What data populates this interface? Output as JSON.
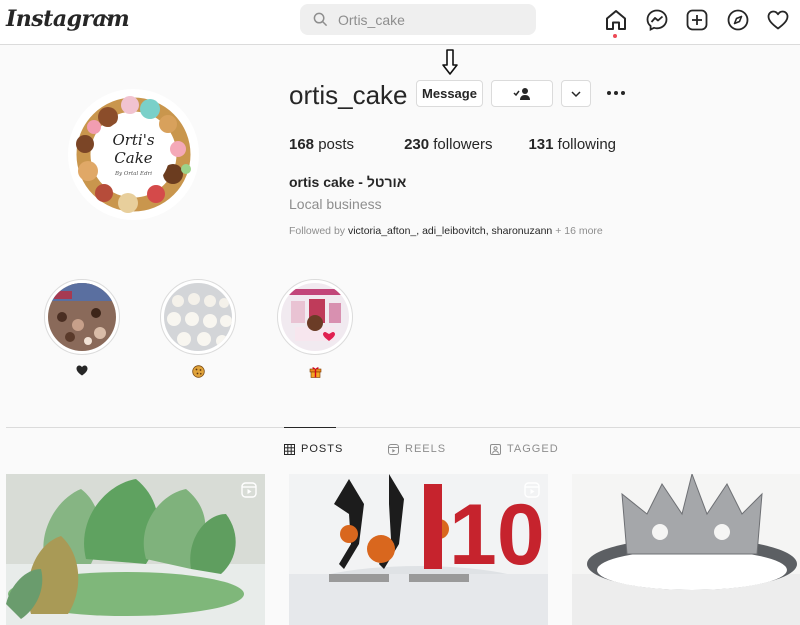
{
  "nav": {
    "logo": "Instagram",
    "search_placeholder": "Search",
    "search_value": "Ortis_cake"
  },
  "profile": {
    "username": "ortis_cake",
    "message_label": "Message",
    "stats": {
      "posts_count": "168",
      "posts_label": "posts",
      "followers_count": "230",
      "followers_label": "followers",
      "following_count": "131",
      "following_label": "following"
    },
    "display_name": "ortis cake - אורטל",
    "category": "Local business",
    "followed_by_prefix": "Followed by",
    "followed_by_names": "victoria_afton_, adi_leibovitch, sharonuzann",
    "followed_by_more": "+ 16 more",
    "avatar_text_line1": "Orti's",
    "avatar_text_line2": "Cake",
    "avatar_text_line3": "By Ortal Edri"
  },
  "highlights": [
    {
      "emoji": "❤"
    },
    {
      "emoji": "🍪"
    },
    {
      "emoji": "🎁"
    }
  ],
  "tabs": [
    {
      "label": "POSTS",
      "active": true
    },
    {
      "label": "REELS",
      "active": false
    },
    {
      "label": "TAGGED",
      "active": false
    }
  ],
  "posts": [
    {
      "subject": "leaf-cake",
      "reel": true
    },
    {
      "subject": "basketball-10-cake",
      "reel": true,
      "cake_number": "10"
    },
    {
      "subject": "crown-cake",
      "reel": false
    }
  ],
  "colors": {
    "accent": "#0095f6",
    "notification": "#ed4956",
    "text": "#262626",
    "muted": "#8e8e8e"
  }
}
